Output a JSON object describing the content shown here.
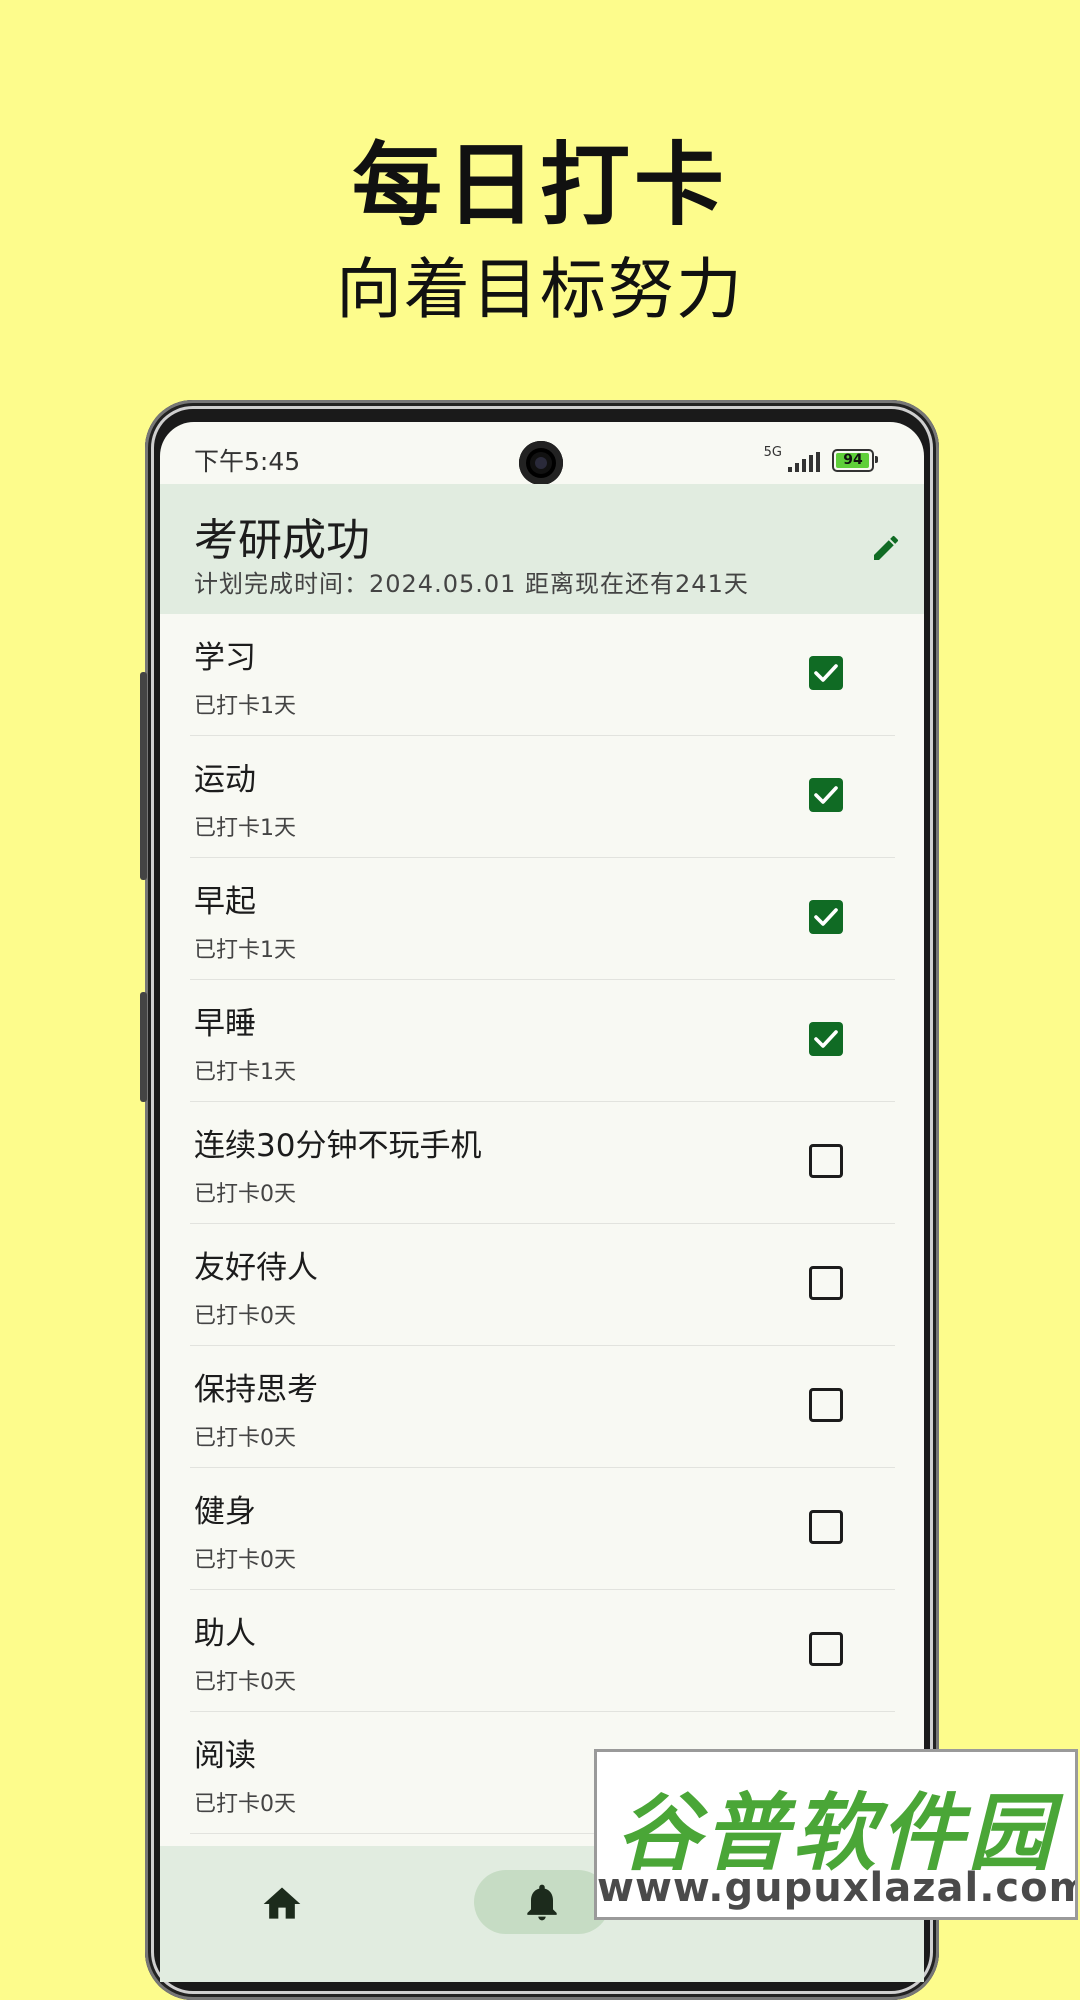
{
  "promo": {
    "headline": "每日打卡",
    "subline": "向着目标努力"
  },
  "status_bar": {
    "time": "下午5:45",
    "network": "5G",
    "battery": "94"
  },
  "header": {
    "title": "考研成功",
    "subtitle": "计划完成时间：2024.05.01 距离现在还有241天",
    "edit_icon": "pencil-icon"
  },
  "habits": [
    {
      "title": "学习",
      "count": "已打卡1天",
      "checked": true
    },
    {
      "title": "运动",
      "count": "已打卡1天",
      "checked": true
    },
    {
      "title": "早起",
      "count": "已打卡1天",
      "checked": true
    },
    {
      "title": "早睡",
      "count": "已打卡1天",
      "checked": true
    },
    {
      "title": "连续30分钟不玩手机",
      "count": "已打卡0天",
      "checked": false
    },
    {
      "title": "友好待人",
      "count": "已打卡0天",
      "checked": false
    },
    {
      "title": "保持思考",
      "count": "已打卡0天",
      "checked": false
    },
    {
      "title": "健身",
      "count": "已打卡0天",
      "checked": false
    },
    {
      "title": "助人",
      "count": "已打卡0天",
      "checked": false
    },
    {
      "title": "阅读",
      "count": "已打卡0天",
      "checked": false
    }
  ],
  "bottom_nav": {
    "items": [
      "home-icon",
      "bell-icon",
      "chart-icon"
    ],
    "selected": "bell-icon"
  },
  "watermark": {
    "brand": "谷普软件园",
    "url": "www.gupuxlazal.com"
  },
  "colors": {
    "background": "#fdfc8c",
    "accent": "#106b24",
    "header_bg": "#e1ece0"
  }
}
